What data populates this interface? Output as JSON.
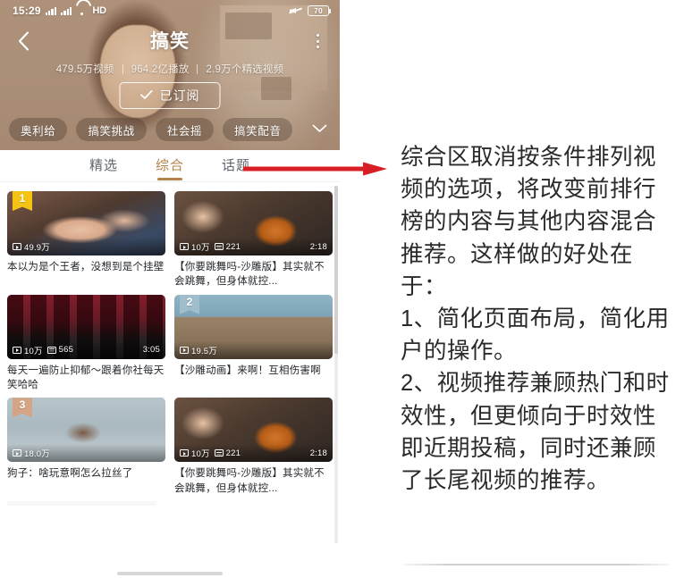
{
  "phone": {
    "status_bar": {
      "time": "15:29",
      "signal_icon": "signal-bars-icon",
      "signal_icon_2": "signal-bars-icon",
      "wifi_icon": "wifi-icon",
      "network_label": "HD",
      "mute_icon": "mute-icon",
      "battery_level": "70"
    },
    "nav": {
      "back_icon": "back-chevron-icon",
      "title": "搞笑",
      "more_icon": "more-vertical-icon"
    },
    "stats": [
      "479.5万视频",
      "964.2亿播放",
      "2.9万个精选视频"
    ],
    "subscribe": {
      "label": "已订阅",
      "check_icon": "check-icon"
    },
    "chips": [
      "奥利给",
      "搞笑挑战",
      "社会摇",
      "搞笑配音"
    ],
    "chips_expand_icon": "chevron-down-icon",
    "tabs": [
      {
        "label": "精选",
        "active": false
      },
      {
        "label": "综合",
        "active": true
      },
      {
        "label": "话题",
        "active": false
      }
    ],
    "accent_color": "#b5824a",
    "videos": [
      {
        "rank": "1",
        "plays": "49.9万",
        "danmaku": "",
        "duration": "",
        "title": "本以为是个王者，没想到是个挂壁",
        "play_icon": "play-count-icon",
        "danmaku_icon": "danmaku-count-icon"
      },
      {
        "rank": "",
        "plays": "10万",
        "danmaku": "221",
        "duration": "2:18",
        "title": "【你要跳舞吗-沙雕版】其实就不会跳舞，但身体就控...",
        "play_icon": "play-count-icon",
        "danmaku_icon": "danmaku-count-icon"
      },
      {
        "rank": "",
        "plays": "10万",
        "danmaku": "565",
        "duration": "3:05",
        "title": "每天一遍防止抑郁～跟着你社每天笑哈哈",
        "play_icon": "play-count-icon",
        "danmaku_icon": "danmaku-count-icon"
      },
      {
        "rank": "2",
        "plays": "19.5万",
        "danmaku": "",
        "duration": "",
        "title": "【沙雕动画】来啊！互相伤害啊",
        "play_icon": "play-count-icon",
        "danmaku_icon": "danmaku-count-icon"
      },
      {
        "rank": "3",
        "plays": "18.0万",
        "danmaku": "",
        "duration": "",
        "title": "狗子：啥玩意啊怎么拉丝了",
        "play_icon": "play-count-icon",
        "danmaku_icon": "danmaku-count-icon"
      },
      {
        "rank": "",
        "plays": "10万",
        "danmaku": "221",
        "duration": "2:18",
        "title": "【你要跳舞吗-沙雕版】其实就不会跳舞，但身体就控...",
        "play_icon": "play-count-icon",
        "danmaku_icon": "danmaku-count-icon"
      }
    ]
  },
  "annotation": {
    "arrow_icon": "red-arrow-right-icon",
    "arrow_color": "#d81f26"
  },
  "note": {
    "paragraphs": [
      "综合区取消按条件排列视频的选项，将改变前排行榜的内容与其他内容混合推荐。这样做的好处在于：",
      "1、简化页面布局，简化用户的操作。",
      "2、视频推荐兼顾热门和时效性，但更倾向于时效性即近期投稿，同时还兼顾了长尾视频的推荐。"
    ]
  }
}
